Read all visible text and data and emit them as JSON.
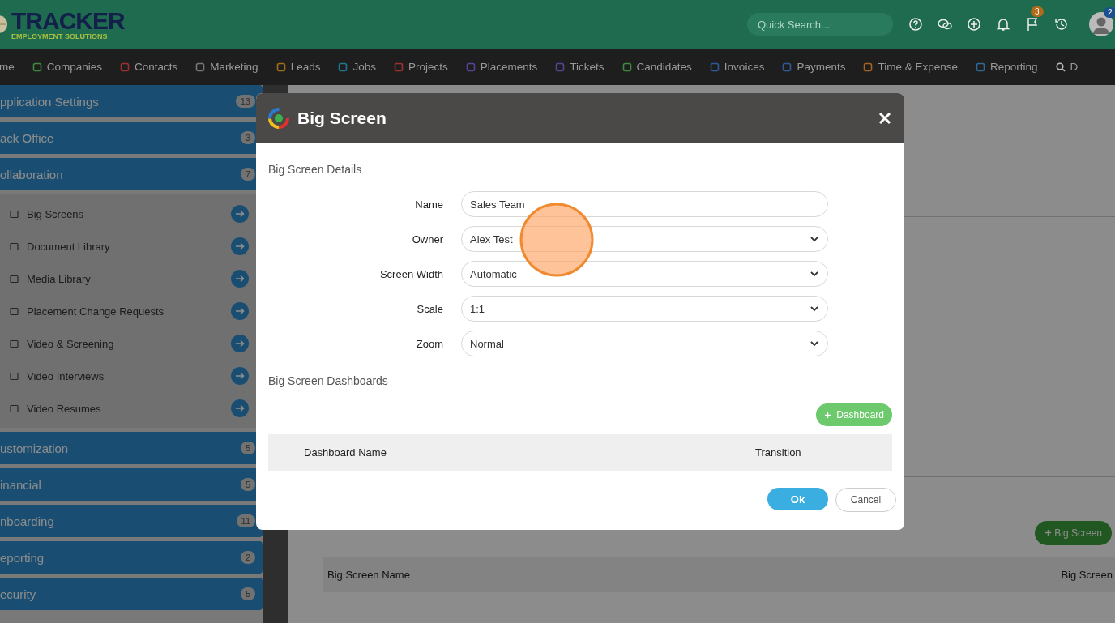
{
  "header": {
    "logo_title": "TRACKER",
    "logo_subtitle": "EMPLOYMENT SOLUTIONS",
    "search": {
      "placeholder": "Quick Search..."
    },
    "flag_badge": "3",
    "avatar_badge": "2"
  },
  "nav": [
    {
      "label": "me"
    },
    {
      "label": "Companies",
      "color": "#3f8a3f"
    },
    {
      "label": "Contacts",
      "color": "#a03030"
    },
    {
      "label": "Marketing",
      "color": "#777777"
    },
    {
      "label": "Leads",
      "color": "#a07018"
    },
    {
      "label": "Jobs",
      "color": "#1f7890"
    },
    {
      "label": "Projects",
      "color": "#a03030"
    },
    {
      "label": "Placements",
      "color": "#5a449a"
    },
    {
      "label": "Tickets",
      "color": "#5a449a"
    },
    {
      "label": "Candidates",
      "color": "#3f8a3f"
    },
    {
      "label": "Invoices",
      "color": "#2c5a9a"
    },
    {
      "label": "Payments",
      "color": "#2c5a9a"
    },
    {
      "label": "Time & Expense",
      "color": "#a86424"
    },
    {
      "label": "Reporting",
      "color": "#2c6a9a"
    },
    {
      "label": "D",
      "color": "#bbbbbb"
    }
  ],
  "sidebar": {
    "groups": [
      {
        "label": "pplication Settings",
        "count": "13"
      },
      {
        "label": "ack Office",
        "count": "3"
      },
      {
        "label": "ollaboration",
        "count": "7",
        "children": [
          {
            "label": "Big Screens"
          },
          {
            "label": "Document Library"
          },
          {
            "label": "Media Library"
          },
          {
            "label": "Placement Change Requests"
          },
          {
            "label": "Video & Screening"
          },
          {
            "label": "Video Interviews"
          },
          {
            "label": "Video Resumes"
          }
        ]
      },
      {
        "label": "ustomization",
        "count": "5"
      },
      {
        "label": "inancial",
        "count": "5"
      },
      {
        "label": "nboarding",
        "count": "11"
      },
      {
        "label": "eporting",
        "count": "2"
      },
      {
        "label": "ecurity",
        "count": "5"
      }
    ]
  },
  "main": {
    "add_button": "Big Screen",
    "table_columns": [
      "Big Screen Name",
      "Big Screen"
    ]
  },
  "modal": {
    "title": "Big Screen",
    "details_heading": "Big Screen Details",
    "fields": [
      {
        "label": "Name",
        "kind": "text",
        "value": "Sales Team"
      },
      {
        "label": "Owner",
        "kind": "select",
        "value": "Alex Test"
      },
      {
        "label": "Screen Width",
        "kind": "select",
        "value": "Automatic"
      },
      {
        "label": "Scale",
        "kind": "select",
        "value": "1:1"
      },
      {
        "label": "Zoom",
        "kind": "select",
        "value": "Normal"
      }
    ],
    "dashboards_heading": "Big Screen Dashboards",
    "add_dashboard": "Dashboard",
    "columns": [
      "Dashboard Name",
      "Transition"
    ],
    "ok": "Ok",
    "cancel": "Cancel"
  }
}
